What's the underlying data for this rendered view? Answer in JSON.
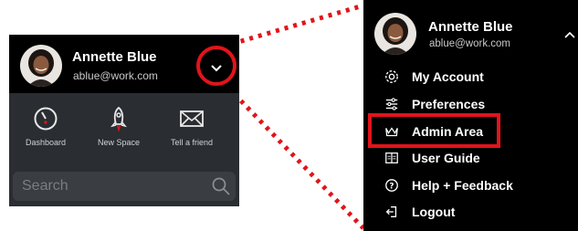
{
  "user": {
    "name": "Annette Blue",
    "email": "ablue@work.com"
  },
  "quick_actions": [
    {
      "label": "Dashboard",
      "icon": "gauge-icon"
    },
    {
      "label": "New Space",
      "icon": "rocket-icon"
    },
    {
      "label": "Tell a friend",
      "icon": "envelope-icon"
    }
  ],
  "search": {
    "placeholder": "Search"
  },
  "menu": {
    "items": [
      {
        "label": "My Account",
        "icon": "gear-icon"
      },
      {
        "label": "Preferences",
        "icon": "sliders-icon"
      },
      {
        "label": "Admin Area",
        "icon": "crown-icon"
      },
      {
        "label": "User Guide",
        "icon": "book-icon"
      },
      {
        "label": "Help + Feedback",
        "icon": "question-circle-icon"
      },
      {
        "label": "Logout",
        "icon": "logout-icon"
      }
    ]
  },
  "colors": {
    "highlight": "#e1141b",
    "panel_dark": "#2a2d31",
    "header_black": "#000000"
  }
}
